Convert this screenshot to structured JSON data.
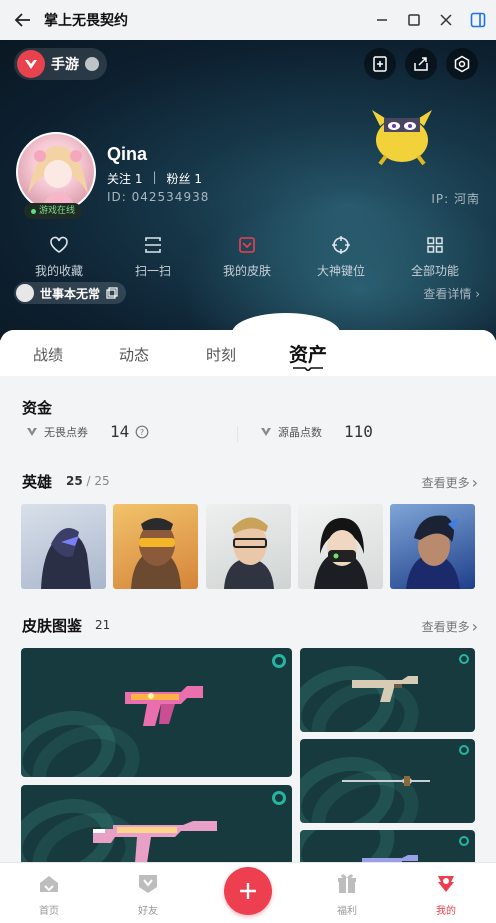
{
  "window": {
    "title": "掌上无畏契约"
  },
  "header": {
    "game_switch_label": "手游",
    "profile": {
      "name": "Qina",
      "following_label": "关注 1",
      "followers_label": "粉丝 1",
      "id_text": "ID: 042534938",
      "ip_text": "IP: 河南",
      "status": "游戏在线"
    },
    "quick_actions": [
      {
        "label": "我的收藏",
        "icon": "heart-icon"
      },
      {
        "label": "扫一扫",
        "icon": "scan-icon"
      },
      {
        "label": "我的皮肤",
        "icon": "skin-icon"
      },
      {
        "label": "大神键位",
        "icon": "crosshair-icon"
      },
      {
        "label": "全部功能",
        "icon": "grid-icon"
      }
    ],
    "motto": "世事本无常",
    "see_detail": "查看详情"
  },
  "tabs": [
    {
      "label": "战绩"
    },
    {
      "label": "动态"
    },
    {
      "label": "时刻"
    },
    {
      "label": "资产",
      "active": true
    }
  ],
  "funds": {
    "title": "资金",
    "items": [
      {
        "label": "无畏点券",
        "value": "14"
      },
      {
        "label": "源晶点数",
        "value": "110"
      }
    ]
  },
  "heroes": {
    "title": "英雄",
    "owned": "25",
    "total": "/ 25",
    "see_more": "查看更多"
  },
  "skins": {
    "title": "皮肤图鉴",
    "count": "21",
    "see_more": "查看更多"
  },
  "bottom_nav": [
    {
      "label": "首页",
      "icon": "home-icon"
    },
    {
      "label": "好友",
      "icon": "friends-icon"
    },
    {
      "label": "",
      "icon": "plus-icon"
    },
    {
      "label": "福利",
      "icon": "gift-icon"
    },
    {
      "label": "我的",
      "icon": "profile-icon",
      "active": true
    }
  ],
  "colors": {
    "accent": "#ee3f51",
    "header_bg": "#0d2030",
    "teal": "#26b5a1"
  }
}
